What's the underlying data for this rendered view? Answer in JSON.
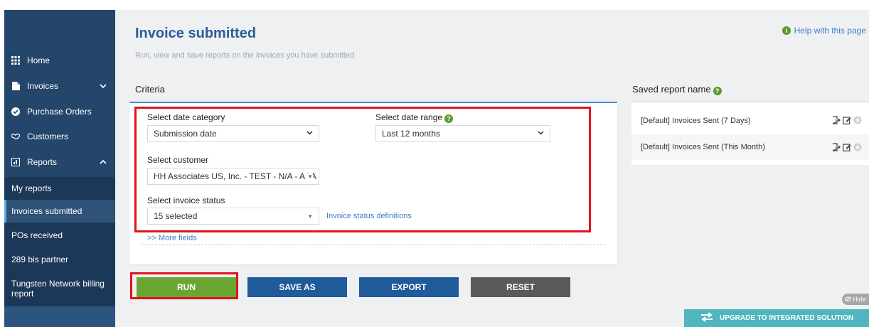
{
  "sidebar": {
    "items": [
      {
        "label": "Home",
        "icon": "grid-icon"
      },
      {
        "label": "Invoices",
        "icon": "document-icon"
      },
      {
        "label": "Purchase Orders",
        "icon": "check-circle-icon"
      },
      {
        "label": "Customers",
        "icon": "handshake-icon"
      },
      {
        "label": "Reports",
        "icon": "report-icon"
      }
    ],
    "sub_items": [
      {
        "label": "My reports"
      },
      {
        "label": "Invoices submitted"
      },
      {
        "label": "POs received"
      },
      {
        "label": "289 bis partner"
      },
      {
        "label": "Tungsten Network billing report"
      }
    ]
  },
  "header": {
    "title": "Invoice submitted",
    "subtitle": "Run, view and save reports on the invoices you have submitted",
    "help": "Help with this page"
  },
  "criteria": {
    "heading": "Criteria",
    "date_category_label": "Select date category",
    "date_category_value": "Submission date",
    "date_range_label": "Select date range",
    "date_range_value": "Last 12 months",
    "customer_label": "Select customer",
    "customer_value": "HH Associates US, Inc. - TEST - N/A - AAA",
    "status_label": "Select invoice status",
    "status_value": "15 selected",
    "status_link": "Invoice status definitions",
    "more_fields": ">> More fields"
  },
  "actions": {
    "run": "RUN",
    "save_as": "SAVE AS",
    "export": "EXPORT",
    "reset": "RESET"
  },
  "saved": {
    "heading": "Saved report name",
    "reports": [
      {
        "name": "[Default] Invoices Sent (7 Days)"
      },
      {
        "name": "[Default] Invoices Sent (This Month)"
      }
    ]
  },
  "footer": {
    "hide": "Hide",
    "upgrade": "UPGRADE TO INTEGRATED SOLUTION"
  },
  "colors": {
    "sidebar": "#24466b",
    "accent_blue": "#1f5a9b",
    "run_green": "#6aa632",
    "highlight_red": "#e0131c"
  }
}
